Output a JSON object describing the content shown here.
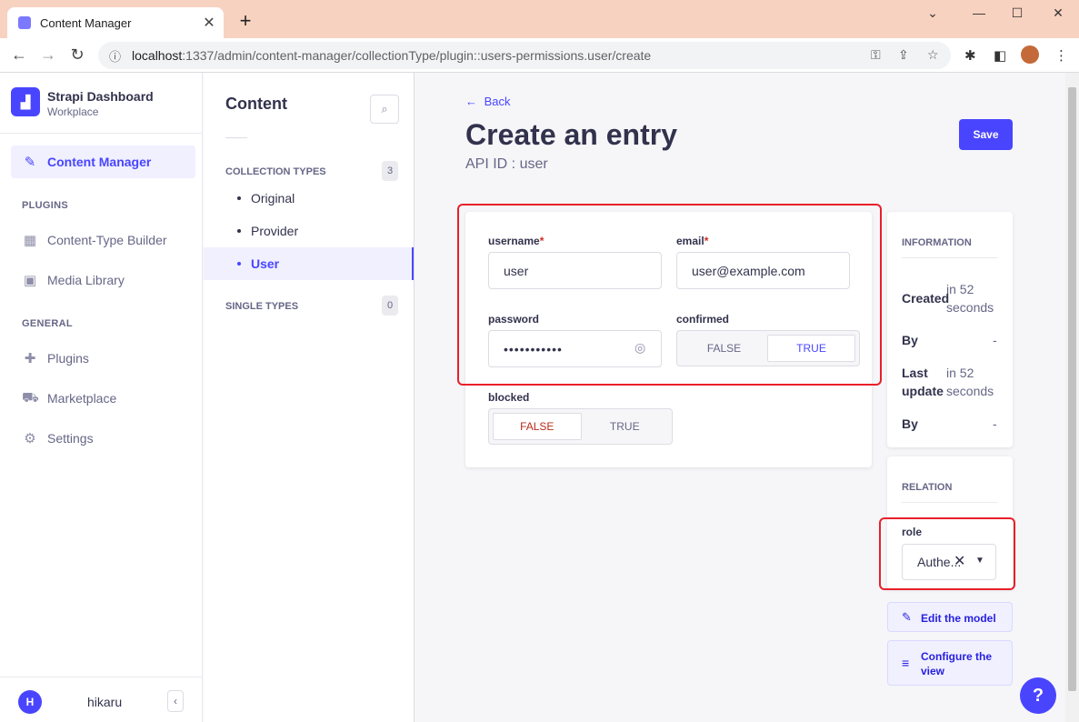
{
  "browser": {
    "tab_title": "Content Manager",
    "tab_close": "✕",
    "new_tab": "+",
    "url_host": "localhost",
    "url_rest": ":1337/admin/content-manager/collectionType/plugin::users-permissions.user/create"
  },
  "nav": {
    "brand_name": "Strapi Dashboard",
    "brand_sub": "Workplace",
    "content_manager": "Content Manager",
    "plugins_section": "PLUGINS",
    "content_type_builder": "Content-Type Builder",
    "media_library": "Media Library",
    "general_section": "GENERAL",
    "plugins": "Plugins",
    "marketplace": "Marketplace",
    "settings": "Settings",
    "user_initial": "H",
    "user_name": "hikaru",
    "collapse": "‹"
  },
  "subnav": {
    "title": "Content",
    "collection_types": "COLLECTION TYPES",
    "collection_count": "3",
    "items": [
      "Original",
      "Provider",
      "User"
    ],
    "single_types": "SINGLE TYPES",
    "single_count": "0"
  },
  "header": {
    "back": "Back",
    "title": "Create an entry",
    "api_id": "API ID : user",
    "save": "Save"
  },
  "form": {
    "username_label": "username",
    "username_value": "user",
    "email_label": "email",
    "email_value": "user@example.com",
    "required_mark": "*",
    "password_label": "password",
    "password_value": "•••••••••••",
    "confirmed_label": "confirmed",
    "confirmed_false": "FALSE",
    "confirmed_true": "TRUE",
    "blocked_label": "blocked",
    "blocked_false": "FALSE",
    "blocked_true": "TRUE"
  },
  "information": {
    "heading": "INFORMATION",
    "created_label": "Created",
    "created_value_1": "in 52",
    "created_value_2": "seconds",
    "by_label": "By",
    "by_value": "-",
    "last_update_label_1": "Last",
    "last_update_label_2": "update",
    "last_update_value_1": "in 52",
    "last_update_value_2": "seconds",
    "by2_label": "By",
    "by2_value": "-"
  },
  "relation": {
    "heading": "RELATION",
    "role_label": "role",
    "role_value": "Authe..."
  },
  "actions": {
    "edit_model": "Edit the model",
    "configure_view_1": "Configure the",
    "configure_view_2": "view",
    "help": "?"
  },
  "colors": {
    "primary": "#4945ff",
    "highlight": "#e8202a",
    "tabbar": "#f8d2c0"
  }
}
